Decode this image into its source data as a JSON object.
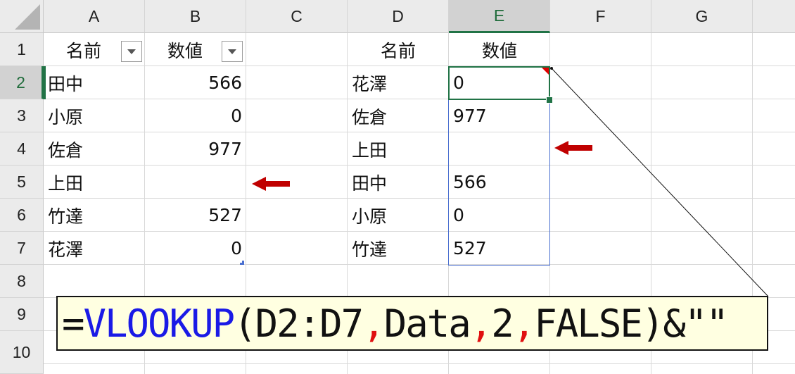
{
  "columns": [
    "A",
    "B",
    "C",
    "D",
    "E",
    "F",
    "G"
  ],
  "rows": [
    "1",
    "2",
    "3",
    "4",
    "5",
    "6",
    "7",
    "8",
    "9",
    "10"
  ],
  "selected_column": "E",
  "selected_row": "2",
  "table1": {
    "header_name": "名前",
    "header_value": "数値",
    "rows": [
      {
        "name": "田中",
        "value": "566"
      },
      {
        "name": "小原",
        "value": "0"
      },
      {
        "name": "佐倉",
        "value": "977"
      },
      {
        "name": "上田",
        "value": ""
      },
      {
        "name": "竹達",
        "value": "527"
      },
      {
        "name": "花澤",
        "value": "0"
      }
    ]
  },
  "table2": {
    "header_name": "名前",
    "header_value": "数値",
    "rows": [
      {
        "name": "花澤",
        "value": "0"
      },
      {
        "name": "佐倉",
        "value": "977"
      },
      {
        "name": "上田",
        "value": ""
      },
      {
        "name": "田中",
        "value": "566"
      },
      {
        "name": "小原",
        "value": "0"
      },
      {
        "name": "竹達",
        "value": "527"
      }
    ]
  },
  "formula": {
    "prefix": "=",
    "function": "VLOOKUP",
    "open": "(D2:D7",
    "sep1": ",",
    "arg2": "Data",
    "sep2": ",",
    "arg3": "2",
    "sep3": ",",
    "arg4": "FALSE)&\"\""
  },
  "colors": {
    "selection": "#217346",
    "function": "#1a1ae6",
    "separator": "#e01010",
    "arrow": "#c00000",
    "comment_bg": "#ffffe1"
  }
}
